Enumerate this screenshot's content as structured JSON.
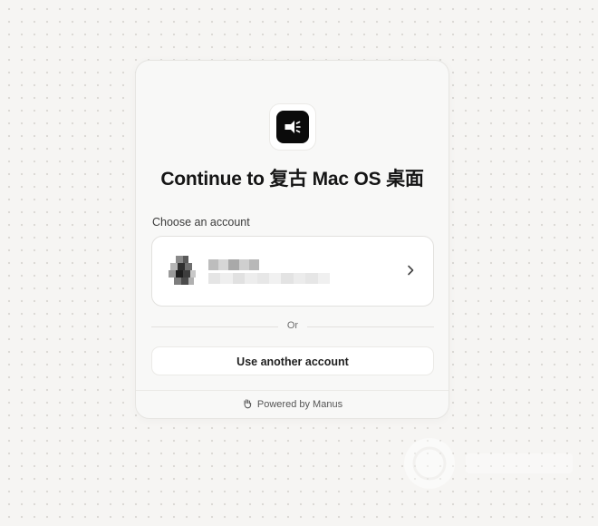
{
  "app": {
    "title": "Continue to 复古 Mac OS 桌面",
    "icon": "speaker-announcement-icon"
  },
  "chooser": {
    "label": "Choose an account",
    "accounts": [
      {
        "name": "",
        "email": "",
        "redacted": true,
        "action_icon": "chevron-right-icon"
      }
    ]
  },
  "divider": {
    "label": "Or"
  },
  "actions": {
    "use_another_label": "Use another account"
  },
  "footer": {
    "icon": "manus-hand-icon",
    "text": "Powered by Manus"
  },
  "colors": {
    "page_background": "#f6f5f3",
    "card_background": "#f8f8f7",
    "app_icon_background": "#0b0b0b",
    "text_primary": "#151515"
  }
}
